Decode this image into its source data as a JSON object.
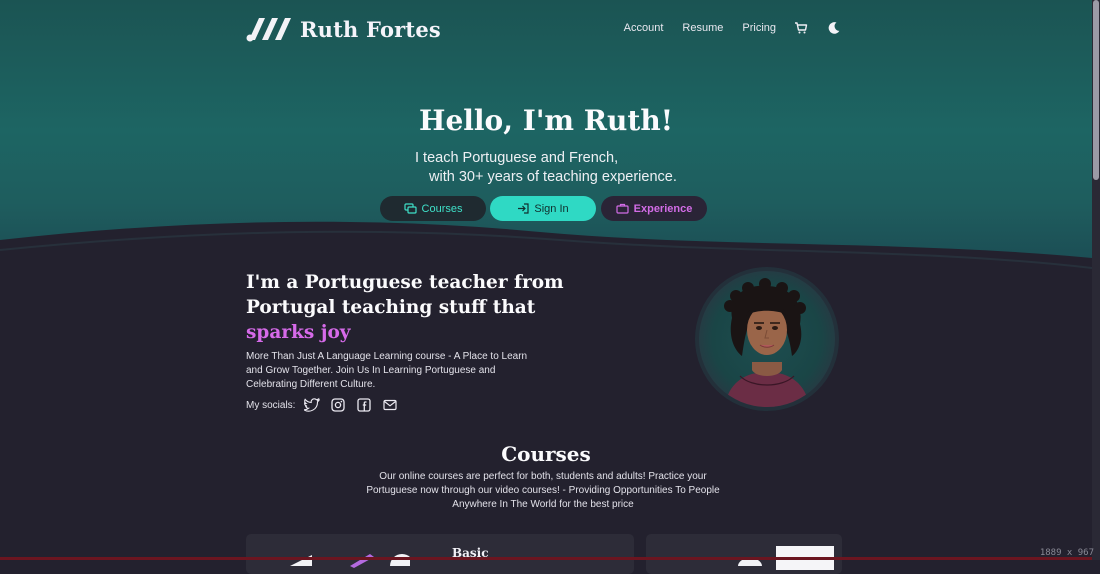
{
  "brand": {
    "name": "Ruth Fortes"
  },
  "nav": {
    "links": [
      "Account",
      "Resume",
      "Pricing"
    ],
    "icons": [
      "cart-icon",
      "moon-icon"
    ]
  },
  "hero": {
    "title": "Hello, I'm Ruth!",
    "line1": "I teach Portuguese and French,",
    "line2": "with 30+ years of teaching experience.",
    "buttons": {
      "courses": "Courses",
      "signin": "Sign In",
      "experience": "Experience"
    }
  },
  "about": {
    "title_part": "I'm a Portuguese teacher from Portugal teaching stuff that",
    "highlight": "sparks joy",
    "description": "More Than Just A Language Learning course - A Place to Learn and Grow Together. Join Us In Learning Portuguese and Celebrating Different Culture.",
    "socials_label": "My socials:",
    "socials": [
      "twitter-icon",
      "instagram-icon",
      "facebook-icon",
      "mail-icon"
    ]
  },
  "courses": {
    "title": "Courses",
    "description": "Our online courses are perfect for both, students and adults! Practice your Portuguese now through our video courses! - Providing Opportunities To People Anywhere In The World for the best price",
    "cards": [
      {
        "title": "Basic"
      },
      {
        "title": ""
      }
    ]
  },
  "window": {
    "dimensions_label": "1889 x 967"
  },
  "colors": {
    "accent_teal": "#2fd9c4",
    "accent_pink": "#d66ae9",
    "background": "#23212e",
    "hero_teal": "#1d6563"
  }
}
